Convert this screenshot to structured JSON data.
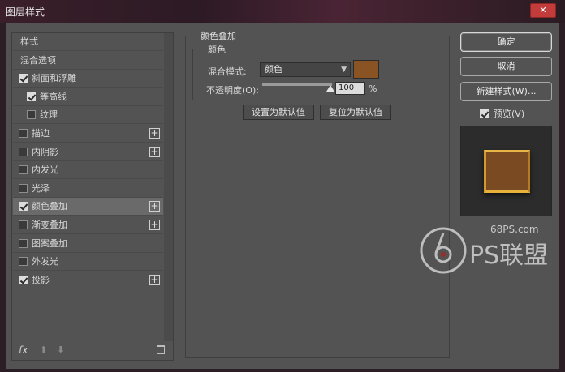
{
  "window": {
    "title": "图层样式",
    "close_symbol": "✕"
  },
  "layer_list": {
    "items": [
      {
        "label": "样式",
        "checkbox": false,
        "checked": false,
        "plus": false,
        "indent": 0
      },
      {
        "label": "混合选项",
        "checkbox": false,
        "checked": false,
        "plus": false,
        "indent": 0
      },
      {
        "label": "斜面和浮雕",
        "checkbox": true,
        "checked": true,
        "plus": false,
        "indent": 0
      },
      {
        "label": "等高线",
        "checkbox": true,
        "checked": true,
        "plus": false,
        "indent": 1
      },
      {
        "label": "纹理",
        "checkbox": true,
        "checked": false,
        "plus": false,
        "indent": 1
      },
      {
        "label": "描边",
        "checkbox": true,
        "checked": false,
        "plus": true,
        "indent": 0
      },
      {
        "label": "内阴影",
        "checkbox": true,
        "checked": false,
        "plus": true,
        "indent": 0
      },
      {
        "label": "内发光",
        "checkbox": true,
        "checked": false,
        "plus": false,
        "indent": 0
      },
      {
        "label": "光泽",
        "checkbox": true,
        "checked": false,
        "plus": false,
        "indent": 0
      },
      {
        "label": "颜色叠加",
        "checkbox": true,
        "checked": true,
        "plus": true,
        "indent": 0,
        "selected": true
      },
      {
        "label": "渐变叠加",
        "checkbox": true,
        "checked": false,
        "plus": true,
        "indent": 0
      },
      {
        "label": "图案叠加",
        "checkbox": true,
        "checked": false,
        "plus": false,
        "indent": 0
      },
      {
        "label": "外发光",
        "checkbox": true,
        "checked": false,
        "plus": false,
        "indent": 0
      },
      {
        "label": "投影",
        "checkbox": true,
        "checked": true,
        "plus": true,
        "indent": 0
      }
    ],
    "footer": {
      "fx": "fx",
      "up": "⬆",
      "down": "⬇"
    }
  },
  "color_overlay": {
    "section_title": "颜色叠加",
    "group_title": "颜色",
    "blend_mode_label": "混合模式:",
    "blend_mode_value": "颜色",
    "overlay_color": "#8a5324",
    "opacity_label": "不透明度(O):",
    "opacity_value": "100",
    "opacity_unit": "%",
    "opacity_percent": 100,
    "set_default_label": "设置为默认值",
    "reset_default_label": "复位为默认值"
  },
  "actions": {
    "ok_label": "确定",
    "cancel_label": "取消",
    "new_style_label": "新建样式(W)...",
    "preview_label": "预览(V)",
    "preview_checked": true
  },
  "watermark": {
    "site": "68PS.com",
    "brand": "PS联盟"
  }
}
